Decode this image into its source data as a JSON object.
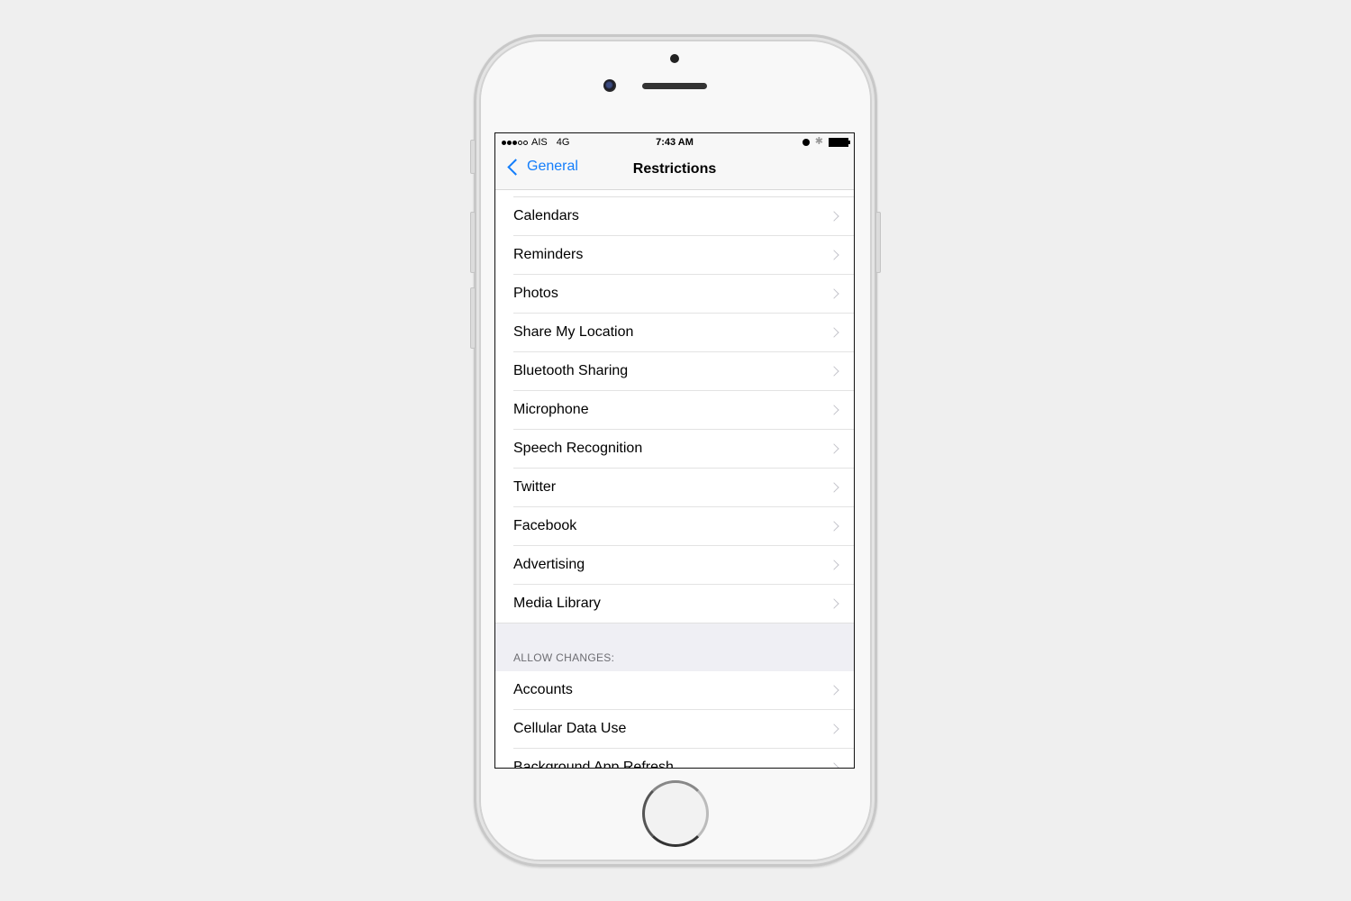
{
  "status_bar": {
    "carrier": "AIS",
    "network": "4G",
    "signal_bars_filled": 3,
    "signal_bars_total": 5,
    "time": "7:43 AM",
    "icons": [
      "alarm-icon",
      "bluetooth-icon",
      "battery-icon"
    ],
    "bluetooth_glyph": "✱"
  },
  "nav": {
    "back_label": "General",
    "title": "Restrictions"
  },
  "section1": {
    "items": [
      {
        "label": "Calendars"
      },
      {
        "label": "Reminders"
      },
      {
        "label": "Photos"
      },
      {
        "label": "Share My Location"
      },
      {
        "label": "Bluetooth Sharing"
      },
      {
        "label": "Microphone"
      },
      {
        "label": "Speech Recognition"
      },
      {
        "label": "Twitter"
      },
      {
        "label": "Facebook"
      },
      {
        "label": "Advertising"
      },
      {
        "label": "Media Library"
      }
    ]
  },
  "section2": {
    "header": "ALLOW CHANGES:",
    "items": [
      {
        "label": "Accounts"
      },
      {
        "label": "Cellular Data Use"
      },
      {
        "label": "Background App Refresh"
      }
    ]
  },
  "colors": {
    "accent": "#147efb",
    "group_background": "#efeff4",
    "section_header_text": "#6d6d72"
  }
}
